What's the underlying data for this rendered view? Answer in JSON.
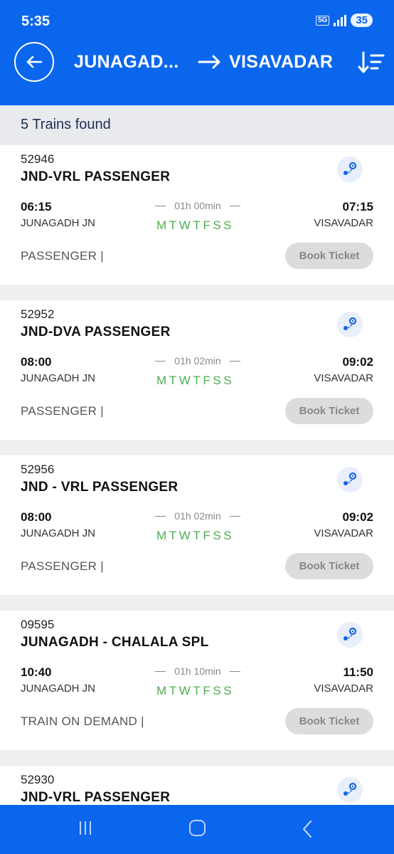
{
  "status_bar": {
    "time": "5:35",
    "network": "5G",
    "battery": "35"
  },
  "header": {
    "from": "JUNAGAD...",
    "to": "VISAVADAR",
    "back_icon": "arrow-left-icon",
    "sort_icon": "sort-icon"
  },
  "results": {
    "count_text": "5 Trains found"
  },
  "trains": [
    {
      "number": "52946",
      "name": "JND-VRL PASSENGER",
      "dep_time": "06:15",
      "dep_station": "JUNAGADH JN",
      "duration": "01h 00min",
      "days": "MTWTFSS",
      "arr_time": "07:15",
      "arr_station": "VISAVADAR",
      "train_class": "PASSENGER |",
      "book_label": "Book Ticket"
    },
    {
      "number": "52952",
      "name": "JND-DVA PASSENGER",
      "dep_time": "08:00",
      "dep_station": "JUNAGADH JN",
      "duration": "01h 02min",
      "days": "MTWTFSS",
      "arr_time": "09:02",
      "arr_station": "VISAVADAR",
      "train_class": "PASSENGER |",
      "book_label": "Book Ticket"
    },
    {
      "number": "52956",
      "name": "JND - VRL PASSENGER",
      "dep_time": "08:00",
      "dep_station": "JUNAGADH JN",
      "duration": "01h 02min",
      "days": "MTWTFSS",
      "arr_time": "09:02",
      "arr_station": "VISAVADAR",
      "train_class": "PASSENGER |",
      "book_label": "Book Ticket"
    },
    {
      "number": "09595",
      "name": "JUNAGADH - CHALALA SPL",
      "dep_time": "10:40",
      "dep_station": "JUNAGADH JN",
      "duration": "01h 10min",
      "days": "MTWTFSS",
      "arr_time": "11:50",
      "arr_station": "VISAVADAR",
      "train_class": "TRAIN ON DEMAND |",
      "book_label": "Book Ticket"
    },
    {
      "number": "52930",
      "name": "JND-VRL PASSENGER"
    }
  ],
  "colors": {
    "primary": "#0b66ee",
    "days_green": "#4caf50",
    "button_disabled": "#dcdcdc"
  }
}
